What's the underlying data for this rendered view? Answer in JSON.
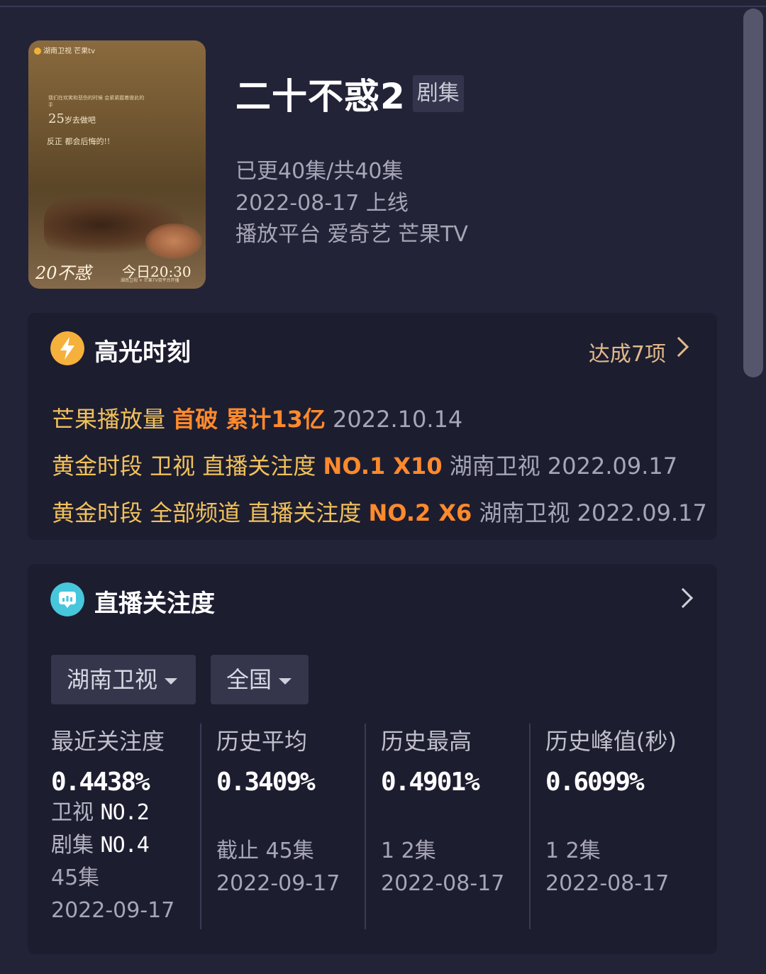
{
  "show": {
    "title": "二十不惑2",
    "type_badge": "剧集",
    "episodes": "已更40集/共40集",
    "release": "2022-08-17 上线",
    "platforms": "播放平台 爱奇艺 芒果TV"
  },
  "poster": {
    "logos": "湖南卫视 芒果tv",
    "tagline_small": "我们在欢笑和悲伤的时候 会紧紧握着彼此的手",
    "tagline_25": "25",
    "tagline_25_rest": "岁去做吧",
    "tagline_2": "反正 都会后悔的!!",
    "title_mark": "20不惑",
    "airtime": "今日20:30",
    "airtime_sub": "湖南卫视 × 芒果TV双平台开播"
  },
  "highlights": {
    "title": "高光时刻",
    "achieved": "达成7项",
    "items": [
      {
        "a": "芒果播放量",
        "b": "首破 累计13亿",
        "c": "2022.10.14"
      },
      {
        "a": "黄金时段 卫视 直播关注度",
        "b": "NO.1 X10",
        "c": "湖南卫视 2022.09.17"
      },
      {
        "a": "黄金时段 全部频道 直播关注度",
        "b": "NO.2 X6",
        "c": "湖南卫视 2022.09.17"
      }
    ]
  },
  "attention": {
    "title": "直播关注度",
    "channel_select": "湖南卫视",
    "region_select": "全国",
    "stats": {
      "recent": {
        "label": "最近关注度",
        "value": "0.4438%",
        "rank1_label": "卫视",
        "rank1": "NO.2",
        "rank2_label": "剧集",
        "rank2": "NO.4",
        "episode": "45集",
        "date": "2022-09-17"
      },
      "average": {
        "label": "历史平均",
        "value": "0.3409%",
        "episode": "截止 45集",
        "date": "2022-09-17"
      },
      "highest": {
        "label": "历史最高",
        "value": "0.4901%",
        "episode": "1 2集",
        "date": "2022-08-17"
      },
      "peak": {
        "label": "历史峰值(秒)",
        "value": "0.6099%",
        "episode": "1 2集",
        "date": "2022-08-17"
      }
    }
  },
  "colors": {
    "background": "#232338",
    "card": "#1d1d30",
    "gold": "#f1c15a",
    "orange": "#ff8a2c",
    "grey": "#a6a6b6"
  }
}
